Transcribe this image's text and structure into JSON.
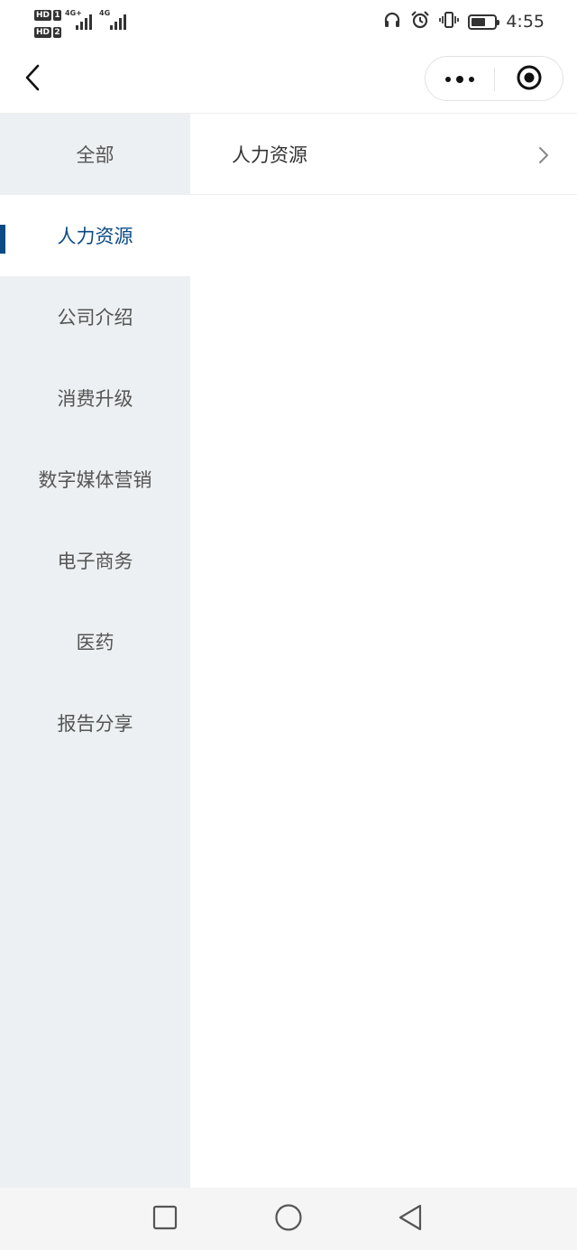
{
  "status_bar": {
    "sim1_tag": "HD",
    "sim1_no": "1",
    "sim2_tag": "HD",
    "sim2_no": "2",
    "net1_label": "4G+",
    "net2_label": "4G",
    "time": "4:55",
    "icons": [
      "headphones-icon",
      "alarm-icon",
      "vibrate-icon",
      "battery-icon"
    ]
  },
  "nav": {
    "icons": [
      "back-arrow-icon",
      "more-dots-icon",
      "target-circle-icon"
    ]
  },
  "sidebar": {
    "items": [
      {
        "label": "全部",
        "active": false
      },
      {
        "label": "人力资源",
        "active": true
      },
      {
        "label": "公司介绍",
        "active": false
      },
      {
        "label": "消费升级",
        "active": false
      },
      {
        "label": "数字媒体营销",
        "active": false
      },
      {
        "label": "电子商务",
        "active": false
      },
      {
        "label": "医药",
        "active": false
      },
      {
        "label": "报告分享",
        "active": false
      }
    ],
    "accent_color": "#0b4a85"
  },
  "content": {
    "rows": [
      {
        "label": "人力资源"
      }
    ]
  },
  "bottom_nav": {
    "icons": [
      "square-recent-icon",
      "circle-home-icon",
      "triangle-back-icon"
    ]
  }
}
